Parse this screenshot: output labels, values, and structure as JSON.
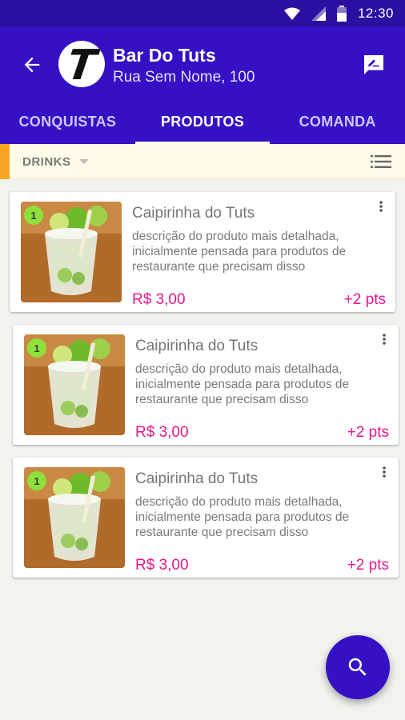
{
  "status_bar": {
    "time": "12:30",
    "icons": [
      "wifi-icon",
      "signal-icon",
      "battery-icon"
    ]
  },
  "header": {
    "logo_letter": "T",
    "title": "Bar Do Tuts",
    "subtitle": "Rua Sem Nome, 100",
    "icons": {
      "back": "arrow-left-icon",
      "edit": "message-edit-icon"
    }
  },
  "tabs": [
    {
      "label": "CONQUISTAS",
      "active": false
    },
    {
      "label": "PRODUTOS",
      "active": true
    },
    {
      "label": "COMANDA",
      "active": false
    }
  ],
  "filter": {
    "category": "DRINKS",
    "view_icon": "list-view-icon"
  },
  "products": [
    {
      "quantity": "1",
      "name": "Caipirinha do Tuts",
      "description": "descrição do produto mais detalhada, inicialmente pensada para produtos de restaurante que precisam disso",
      "price": "R$ 3,00",
      "points": "+2 pts"
    },
    {
      "quantity": "1",
      "name": "Caipirinha do Tuts",
      "description": "descrição do produto mais detalhada, inicialmente pensada para produtos de restaurante que precisam disso",
      "price": "R$ 3,00",
      "points": "+2 pts"
    },
    {
      "quantity": "1",
      "name": "Caipirinha do Tuts",
      "description": "descrição do produto mais detalhada, inicialmente pensada para produtos de restaurante que precisam disso",
      "price": "R$ 3,00",
      "points": "+2 pts"
    }
  ],
  "fab": {
    "icon": "search-icon"
  },
  "colors": {
    "primary": "#3510c4",
    "status_bar": "#2c0fa0",
    "accent_pink": "#e6198a",
    "badge_green": "#8ee03b",
    "filter_accent": "#f6a623",
    "filter_bg": "#fffbe8",
    "background": "#f2f2ef"
  }
}
